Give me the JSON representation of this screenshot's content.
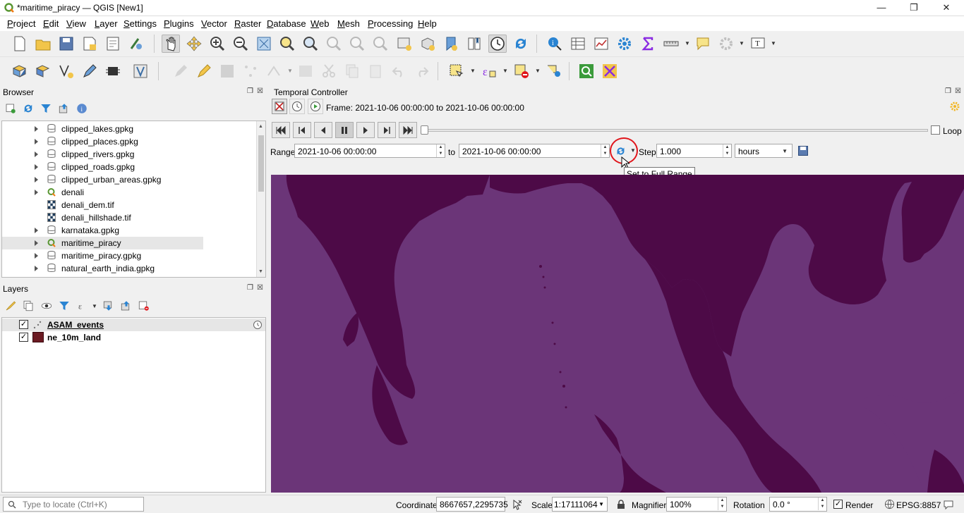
{
  "window": {
    "title": "*maritime_piracy — QGIS [New1]",
    "controls": [
      "—",
      "❐",
      "✕"
    ]
  },
  "menu": [
    "Project",
    "Edit",
    "View",
    "Layer",
    "Settings",
    "Plugins",
    "Vector",
    "Raster",
    "Database",
    "Web",
    "Mesh",
    "Processing",
    "Help"
  ],
  "browser": {
    "title": "Browser",
    "items": [
      {
        "label": "clipped_lakes.gpkg",
        "type": "gpkg",
        "expandable": true
      },
      {
        "label": "clipped_places.gpkg",
        "type": "gpkg",
        "expandable": true
      },
      {
        "label": "clipped_rivers.gpkg",
        "type": "gpkg",
        "expandable": true
      },
      {
        "label": "clipped_roads.gpkg",
        "type": "gpkg",
        "expandable": true
      },
      {
        "label": "clipped_urban_areas.gpkg",
        "type": "gpkg",
        "expandable": true
      },
      {
        "label": "denali",
        "type": "qgs",
        "expandable": true
      },
      {
        "label": "denali_dem.tif",
        "type": "raster",
        "expandable": false
      },
      {
        "label": "denali_hillshade.tif",
        "type": "raster",
        "expandable": false
      },
      {
        "label": "karnataka.gpkg",
        "type": "gpkg",
        "expandable": true
      },
      {
        "label": "maritime_piracy",
        "type": "qgs",
        "expandable": true,
        "selected": true
      },
      {
        "label": "maritime_piracy.gpkg",
        "type": "gpkg",
        "expandable": true
      },
      {
        "label": "natural_earth_india.gpkg",
        "type": "gpkg",
        "expandable": true
      }
    ]
  },
  "layers": {
    "title": "Layers",
    "items": [
      {
        "label": "ASAM_events",
        "checked": true,
        "temporal": true,
        "bold": true,
        "underline": true,
        "color": "#555555"
      },
      {
        "label": "ne_10m_land",
        "checked": true,
        "temporal": false,
        "bold": true,
        "underline": false,
        "color": "#6b1a22"
      }
    ]
  },
  "temporal": {
    "title": "Temporal Controller",
    "frame_text": "Frame: 2021-10-06 00:00:00 to 2021-10-06 00:00:00",
    "loop_label": "Loop",
    "loop_checked": false,
    "range_label": "Range",
    "range_start": "2021-10-06 00:00:00",
    "to_label": "to",
    "range_end": "2021-10-06 00:00:00",
    "step_label": "Step",
    "step_value": "1.000",
    "step_unit": "hours",
    "tooltip": "Set to Full Range",
    "slider_position": 0
  },
  "status": {
    "locator_placeholder": "Type to locate (Ctrl+K)",
    "coordinate_label": "Coordinate",
    "coordinate_value": "8667657,2295735",
    "scale_label": "Scale",
    "scale_value": "1:17111064",
    "magnifier_label": "Magnifier",
    "magnifier_value": "100%",
    "rotation_label": "Rotation",
    "rotation_value": "0.0 °",
    "render_label": "Render",
    "render_checked": true,
    "crs": "EPSG:8857"
  },
  "colors": {
    "map_sea": "#6b3578",
    "map_land": "#4d0a47",
    "highlight": "#e0151b"
  }
}
